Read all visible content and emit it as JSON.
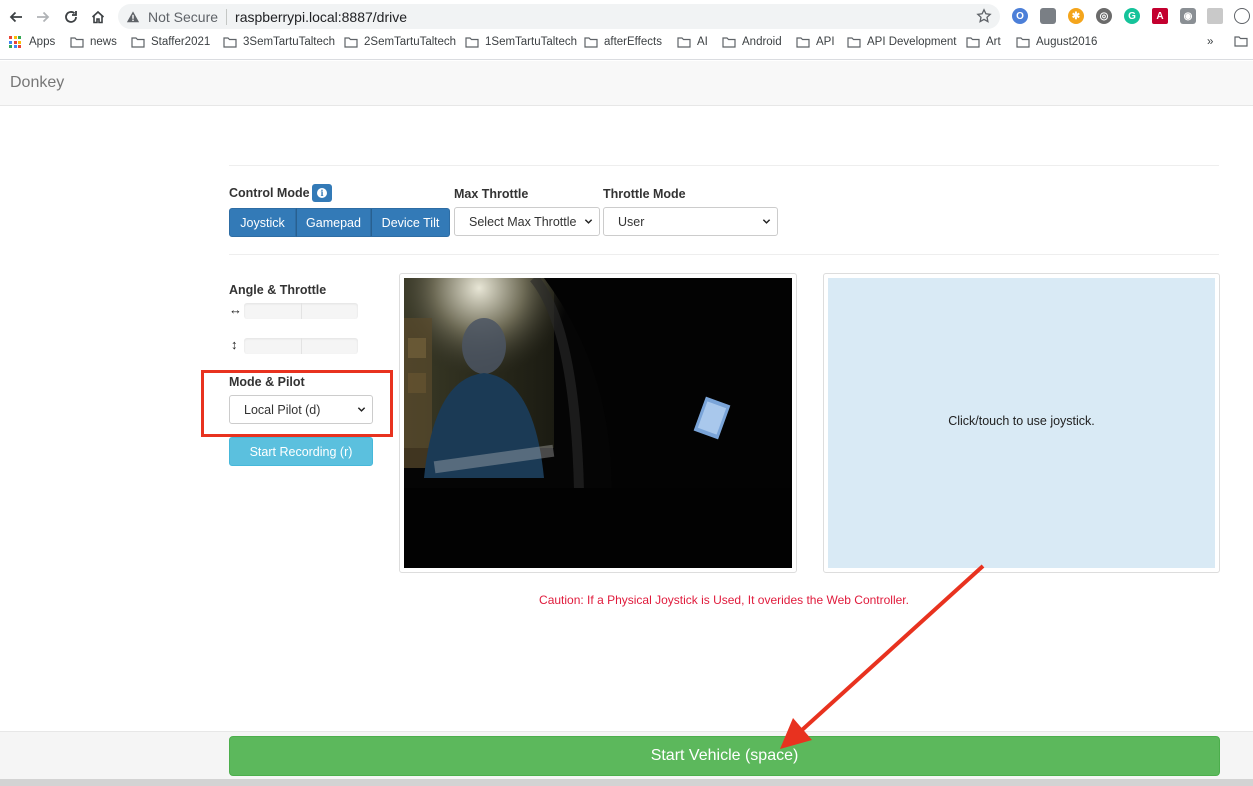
{
  "browser": {
    "security_label": "Not Secure",
    "url": "raspberrypi.local:8887/drive",
    "bookmarks": [
      {
        "label": "Apps"
      },
      {
        "label": "news"
      },
      {
        "label": "Staffer2021"
      },
      {
        "label": "3SemTartuTaltech"
      },
      {
        "label": "2SemTartuTaltech"
      },
      {
        "label": "1SemTartuTaltech"
      },
      {
        "label": "afterEffects"
      },
      {
        "label": "AI"
      },
      {
        "label": "Android"
      },
      {
        "label": "API"
      },
      {
        "label": "API Development"
      },
      {
        "label": "Art"
      },
      {
        "label": "August2016"
      }
    ],
    "overflow": "»"
  },
  "app": {
    "brand": "Donkey",
    "control_mode": {
      "label": "Control Mode",
      "options": [
        "Joystick",
        "Gamepad",
        "Device Tilt"
      ]
    },
    "max_throttle": {
      "label": "Max Throttle",
      "value": "Select Max Throttle"
    },
    "throttle_mode": {
      "label": "Throttle Mode",
      "value": "User"
    },
    "angle_throttle": {
      "label": "Angle & Throttle",
      "angle_icon": "↔",
      "throttle_icon": "↕"
    },
    "mode_pilot": {
      "label": "Mode & Pilot",
      "value": "Local Pilot (d)"
    },
    "record_button": "Start Recording (r)",
    "joystick_hint": "Click/touch to use joystick.",
    "caution": "Caution: If a Physical Joystick is Used, It overides the Web Controller.",
    "start_button": "Start Vehicle (space)"
  },
  "colors": {
    "primary": "#337ab7",
    "info": "#5bc0de",
    "success": "#5cb85c",
    "danger_text": "#e01b3c",
    "annotation": "#e8321f"
  }
}
